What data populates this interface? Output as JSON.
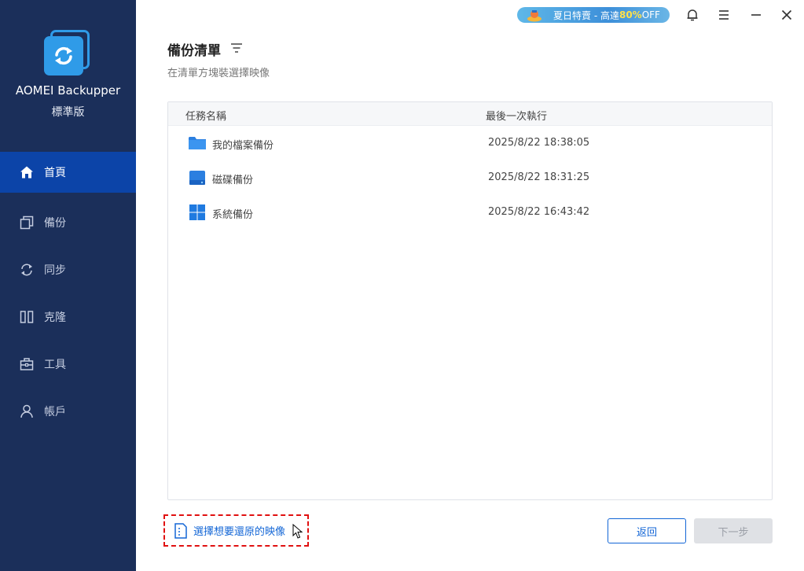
{
  "app": {
    "name": "AOMEI Backupper",
    "edition": "標準版"
  },
  "sidebar": {
    "items": [
      {
        "label": "首頁",
        "icon": "home-icon",
        "active": true
      },
      {
        "label": "備份",
        "icon": "backup-icon",
        "active": false
      },
      {
        "label": "同步",
        "icon": "sync-icon",
        "active": false
      },
      {
        "label": "克隆",
        "icon": "clone-icon",
        "active": false
      },
      {
        "label": "工具",
        "icon": "tools-icon",
        "active": false
      },
      {
        "label": "帳戶",
        "icon": "account-icon",
        "active": false
      }
    ]
  },
  "titlebar": {
    "promo_prefix": "夏日特賣 - 高達",
    "promo_highlight": "80%",
    "promo_suffix": "OFF"
  },
  "main": {
    "title": "備份清單",
    "subtitle": "在清單方塊裝選擇映像",
    "columns": {
      "name": "任務名稱",
      "last_run": "最後一次執行"
    },
    "rows": [
      {
        "name": "我的檔案備份",
        "time": "2025/8/22 18:38:05",
        "icon": "folder-icon"
      },
      {
        "name": "磁碟備份",
        "time": "2025/8/22 18:31:25",
        "icon": "disk-icon"
      },
      {
        "name": "系統備份",
        "time": "2025/8/22 16:43:42",
        "icon": "windows-icon"
      }
    ]
  },
  "footer": {
    "select_image": "選擇想要還原的映像",
    "back": "返回",
    "next": "下一步"
  },
  "colors": {
    "sidebar_bg": "#1b2f5a",
    "sidebar_active": "#0c44a8",
    "accent": "#1366d6",
    "highlight_border": "#e01010"
  }
}
